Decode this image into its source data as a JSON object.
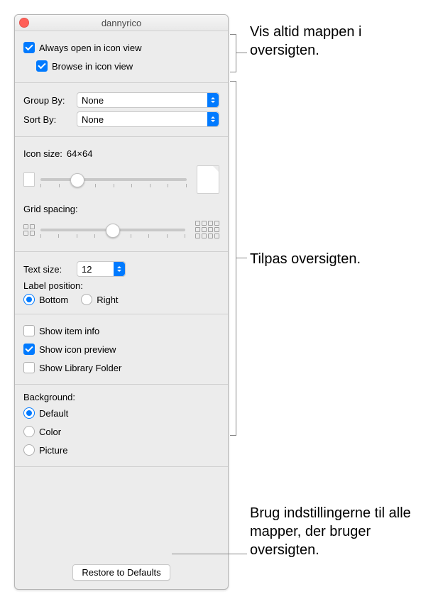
{
  "window": {
    "title": "dannyrico"
  },
  "view": {
    "always_open_label": "Always open in icon view",
    "always_open_checked": true,
    "browse_label": "Browse in icon view",
    "browse_checked": true
  },
  "arrange": {
    "group_by_label": "Group By:",
    "group_by_value": "None",
    "sort_by_label": "Sort By:",
    "sort_by_value": "None"
  },
  "icon": {
    "size_label": "Icon size:",
    "size_value": "64×64",
    "grid_label": "Grid spacing:"
  },
  "text": {
    "size_label": "Text size:",
    "size_value": "12",
    "label_position_heading": "Label position:",
    "bottom_label": "Bottom",
    "right_label": "Right"
  },
  "show": {
    "item_info_label": "Show item info",
    "item_info_checked": false,
    "icon_preview_label": "Show icon preview",
    "icon_preview_checked": true,
    "library_label": "Show Library Folder",
    "library_checked": false
  },
  "background": {
    "heading": "Background:",
    "default_label": "Default",
    "color_label": "Color",
    "picture_label": "Picture"
  },
  "footer": {
    "restore_label": "Restore to Defaults"
  },
  "annotations": {
    "a1": "Vis altid mappen i oversigten.",
    "a2": "Tilpas oversigten.",
    "a3": "Brug indstillingerne til alle mapper, der bruger oversigten."
  }
}
